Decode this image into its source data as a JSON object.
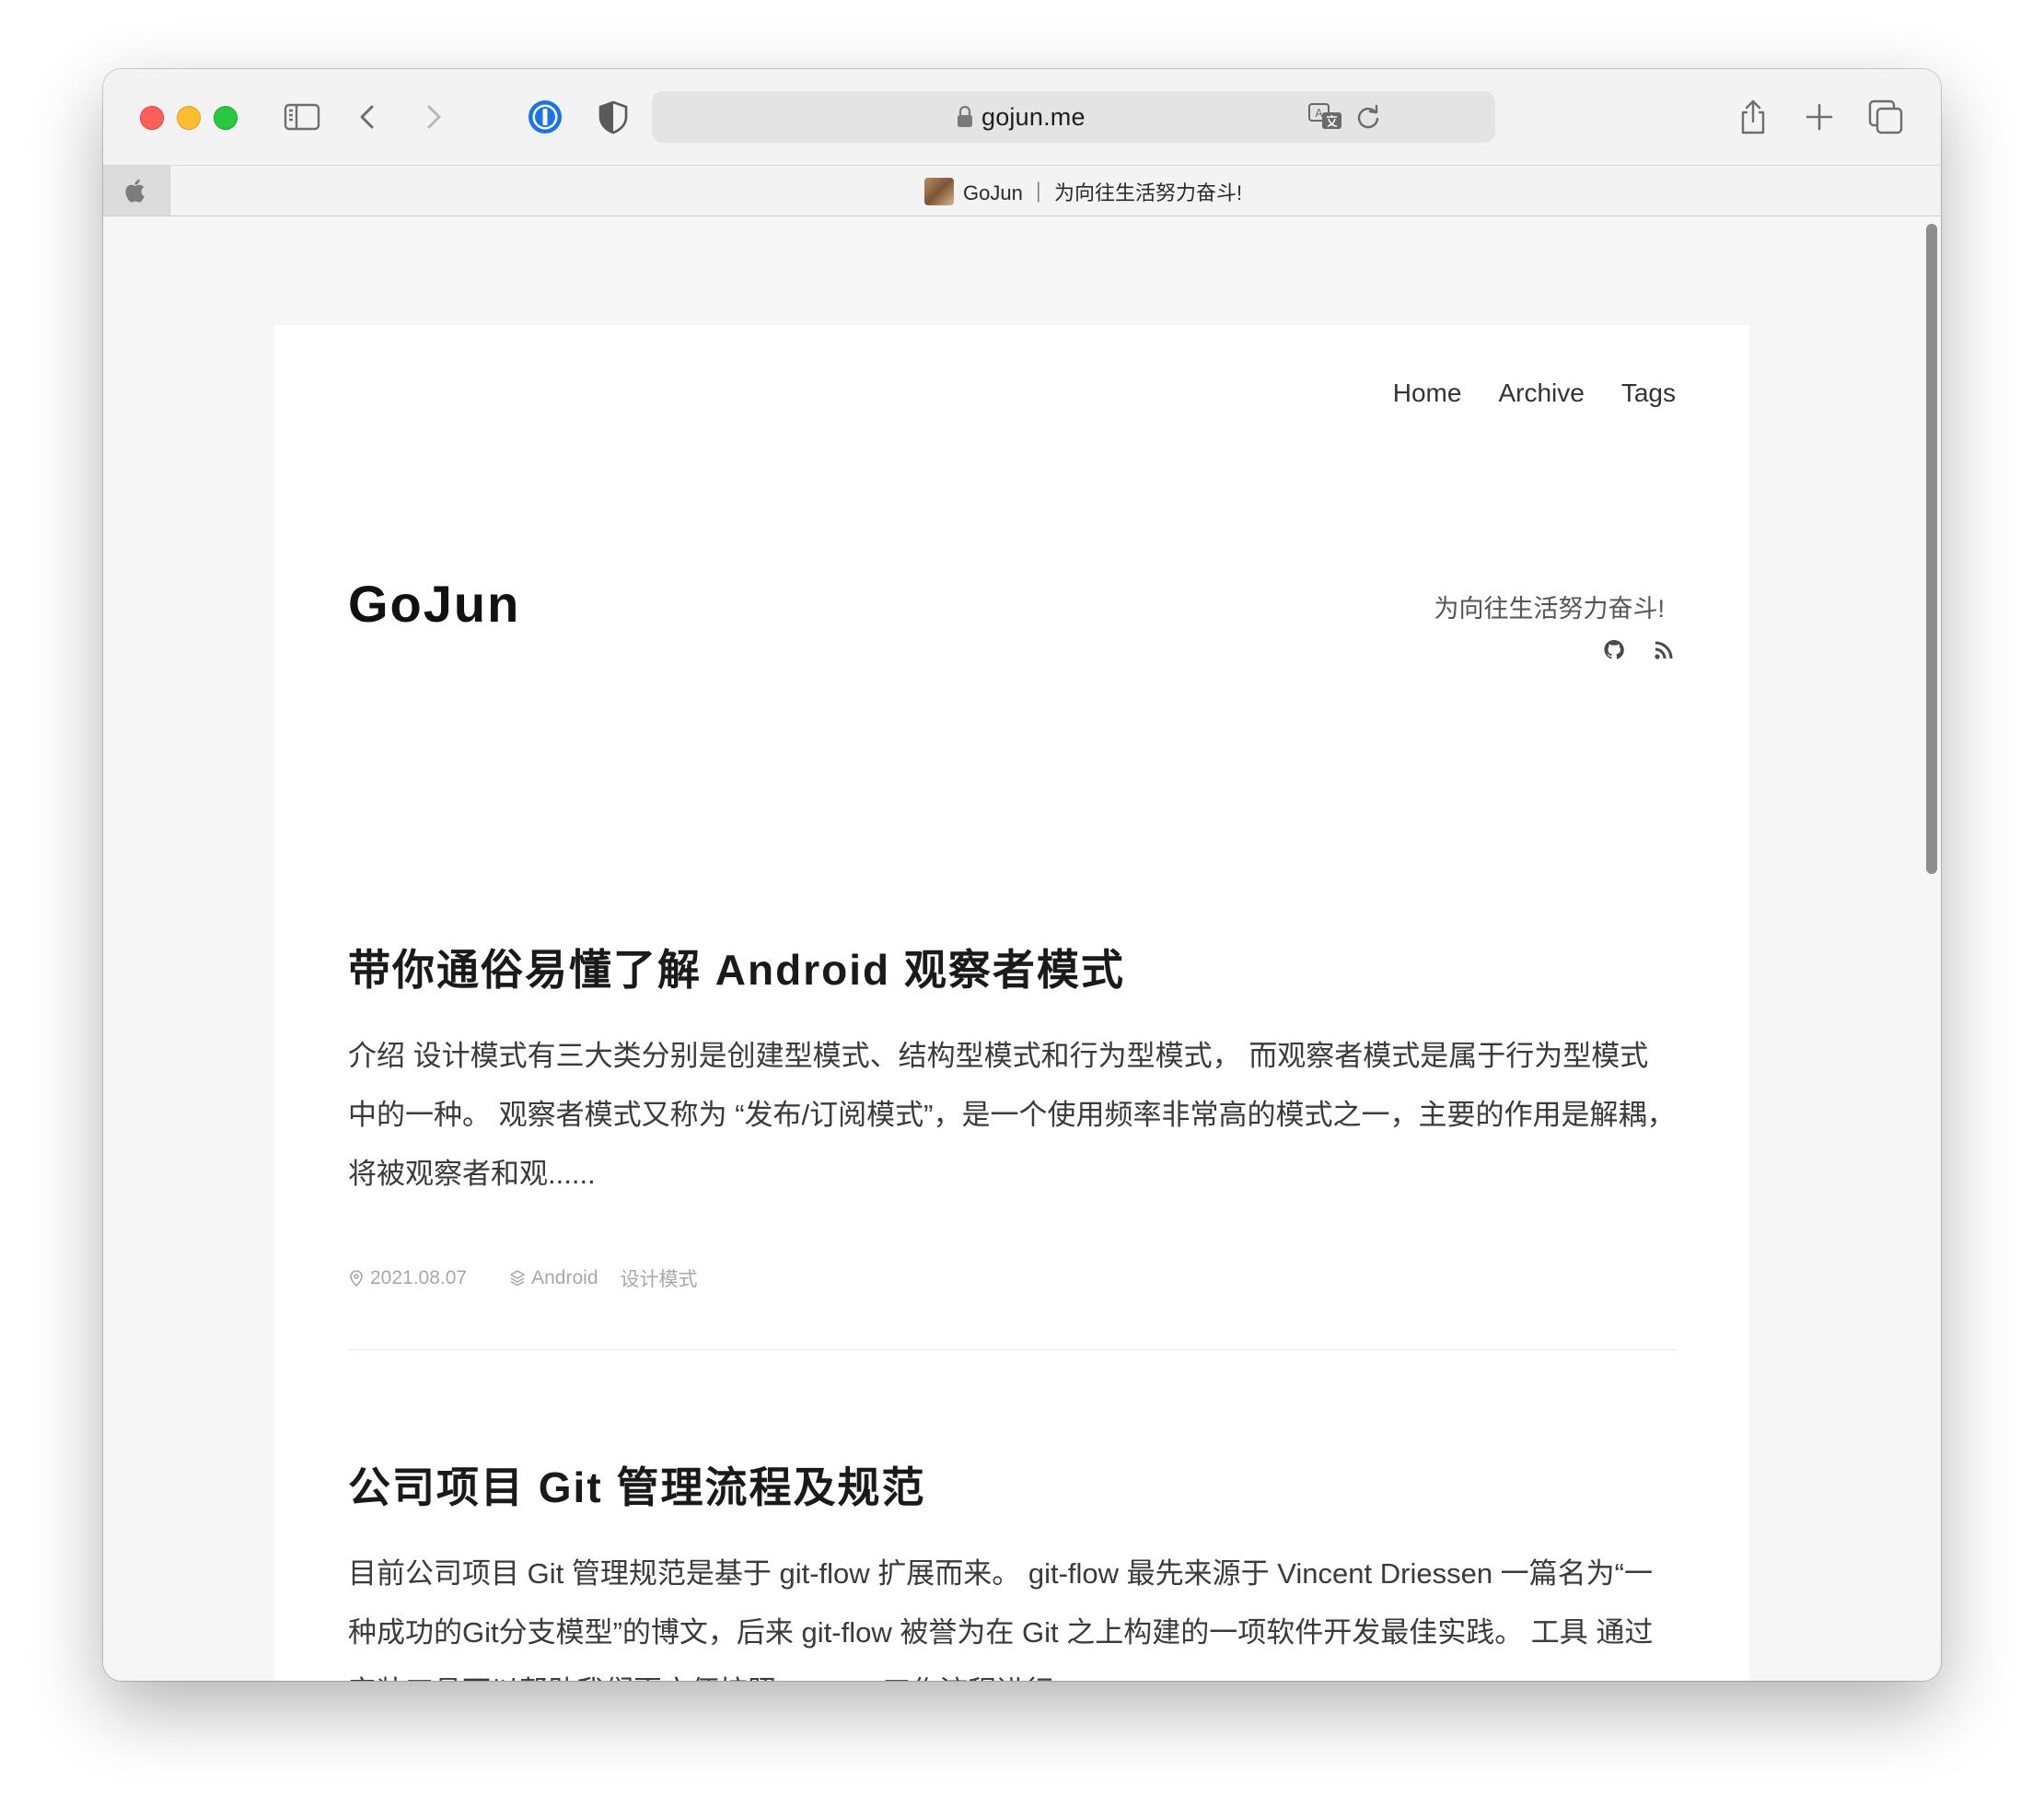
{
  "browser": {
    "url": "gojun.me",
    "tab_title": "GoJun ｜ 为向往生活努力奋斗!"
  },
  "site": {
    "title": "GoJun",
    "tagline": "为向往生活努力奋斗!",
    "nav": [
      "Home",
      "Archive",
      "Tags"
    ]
  },
  "posts": [
    {
      "title": "带你通俗易懂了解 Android 观察者模式",
      "excerpt": "介绍 设计模式有三大类分别是创建型模式、结构型模式和行为型模式， 而观察者模式是属于行为型模式中的一种。 观察者模式又称为 “发布/订阅模式”，是一个使用频率非常高的模式之一，主要的作用是解耦，将被观察者和观......",
      "date": "2021.08.07",
      "categories": [
        "Android",
        "设计模式"
      ]
    },
    {
      "title": "公司项目 Git 管理流程及规范",
      "excerpt": "目前公司项目 Git 管理规范是基于 git-flow 扩展而来。 git-flow 最先来源于 Vincent Driessen 一篇名为“一种成功的Git分支模型”的博文，后来 git-flow 被誉为在 Git 之上构建的一项软件开发最佳实践。 工具 通过安装工具可以帮助我们更方便按照 git-flow 工作流程进行"
    }
  ]
}
